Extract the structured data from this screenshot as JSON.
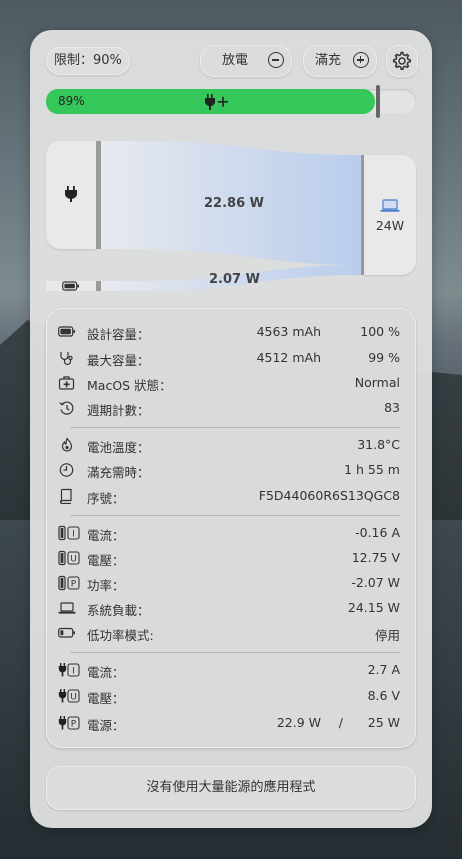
{
  "header": {
    "limit_label": "限制：90%",
    "discharge_label": "放電",
    "full_charge_label": "滿充"
  },
  "battery_bar": {
    "percent_text": "89%",
    "level": 0.89,
    "fill_color": "#35c759"
  },
  "power_flow": {
    "main_flow_label": "22.86 W",
    "battery_flow_label": "2.07 W",
    "system_load_label": "24W"
  },
  "info": {
    "group1": [
      {
        "icon": "battery-icon",
        "label": "設計容量：",
        "value": "4563 mAh",
        "value2": "100 %"
      },
      {
        "icon": "stethoscope-icon",
        "label": "最大容量：",
        "value": "4512 mAh",
        "value2": "99 %"
      },
      {
        "icon": "medical-kit-icon",
        "label": "MacOS 狀態：",
        "value": "Normal"
      },
      {
        "icon": "history-icon",
        "label": "週期計數：",
        "value": "83"
      }
    ],
    "group2": [
      {
        "icon": "thermometer-icon",
        "label": "電池溫度：",
        "value": "31.8°C"
      },
      {
        "icon": "clock-icon",
        "label": "滿充需時：",
        "value": "1 h 55 m"
      },
      {
        "icon": "book-icon",
        "label": "序號：",
        "value": "F5D44060R6S13QGC8"
      }
    ],
    "group3": [
      {
        "icon": "battery-current-icon",
        "badge": "I",
        "label": "電流：",
        "value": "-0.16 A"
      },
      {
        "icon": "battery-voltage-icon",
        "badge": "U",
        "label": "電壓：",
        "value": "12.75 V"
      },
      {
        "icon": "battery-power-icon",
        "badge": "P",
        "label": "功率：",
        "value": "-2.07 W"
      },
      {
        "icon": "laptop-icon",
        "label": "系統負載：",
        "value": "24.15 W"
      },
      {
        "icon": "low-power-battery-icon",
        "label": "低功率模式:",
        "value": "停用"
      }
    ],
    "group4": [
      {
        "icon": "adapter-current-icon",
        "badge": "I",
        "label": "電流：",
        "value": "2.7 A"
      },
      {
        "icon": "adapter-voltage-icon",
        "badge": "U",
        "label": "電壓：",
        "value": "8.6 V"
      },
      {
        "icon": "adapter-power-icon",
        "badge": "P",
        "label": "電源：",
        "value": "22.9 W",
        "separator": "/",
        "value2": "25 W"
      }
    ]
  },
  "footer": {
    "message": "沒有使用大量能源的應用程式"
  },
  "colors": {
    "accent_green": "#35c759",
    "flow_blue": "#b9cdec",
    "laptop_blue": "#4a7fd0"
  }
}
